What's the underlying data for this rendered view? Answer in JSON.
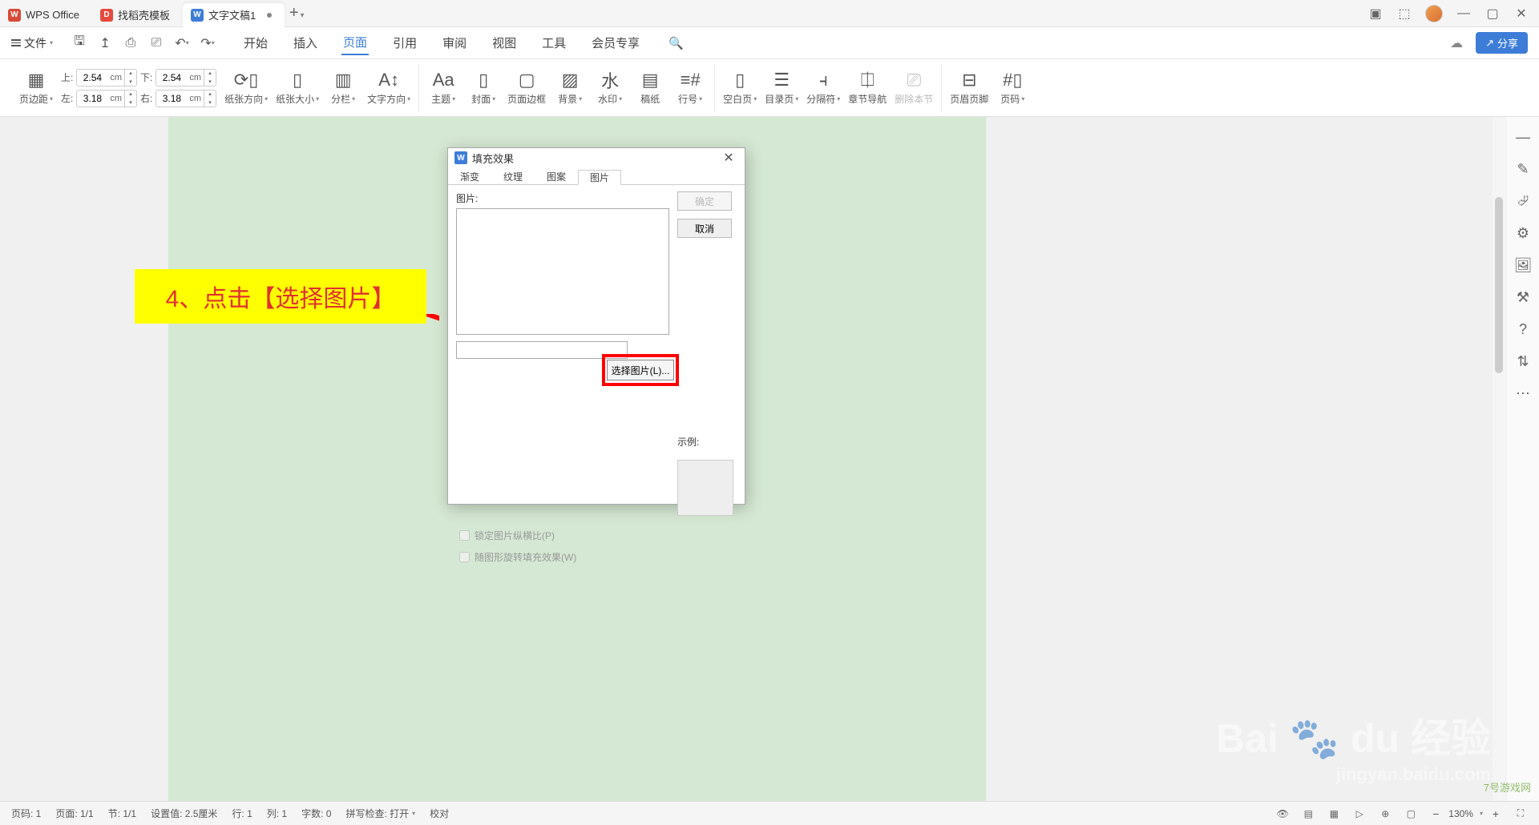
{
  "titlebar": {
    "tabs": [
      {
        "label": "WPS Office"
      },
      {
        "label": "找稻壳模板"
      },
      {
        "label": "文字文稿1"
      }
    ],
    "add": "+"
  },
  "menubar": {
    "file": "文件",
    "menus": [
      "开始",
      "插入",
      "页面",
      "引用",
      "审阅",
      "视图",
      "工具",
      "会员专享"
    ],
    "active_index": 2,
    "share": "分享"
  },
  "ribbon": {
    "margins": {
      "label": "页边距",
      "top_lbl": "上:",
      "top": "2.54",
      "bottom_lbl": "下:",
      "bottom": "2.54",
      "left_lbl": "左:",
      "left": "3.18",
      "right_lbl": "右:",
      "right": "3.18",
      "unit": "cm"
    },
    "orientation": "纸张方向",
    "size": "纸张大小",
    "columns": "分栏",
    "textdir": "文字方向",
    "theme": "主题",
    "cover": "封面",
    "border": "页面边框",
    "background": "背景",
    "watermark": "水印",
    "draft": "稿纸",
    "linenum": "行号",
    "blank": "空白页",
    "toc": "目录页",
    "separator": "分隔符",
    "chapternav": "章节导航",
    "delsec": "删除本节",
    "headerfooter": "页眉页脚",
    "pagenum": "页码"
  },
  "callout": "4、点击【选择图片】",
  "dialog": {
    "title": "填充效果",
    "tabs": [
      "渐变",
      "纹理",
      "图案",
      "图片"
    ],
    "active_tab": 3,
    "pic_label": "图片:",
    "select_btn": "选择图片(L)...",
    "ok": "确定",
    "cancel": "取消",
    "example": "示例:",
    "lock_aspect": "锁定图片纵横比(P)",
    "rotate_fill": "随图形旋转填充效果(W)"
  },
  "statusbar": {
    "page_no": "页码: 1",
    "page": "页面: 1/1",
    "section": "节: 1/1",
    "setval": "设置值: 2.5厘米",
    "row": "行: 1",
    "col": "列: 1",
    "chars": "字数: 0",
    "spell": "拼写检查: 打开",
    "proof": "校对",
    "zoom": "130%"
  },
  "watermark": {
    "main": "Bai",
    "du": "du",
    "exp": "经验",
    "sub": "jingyan.baidu.com"
  },
  "site": "7号游戏网"
}
